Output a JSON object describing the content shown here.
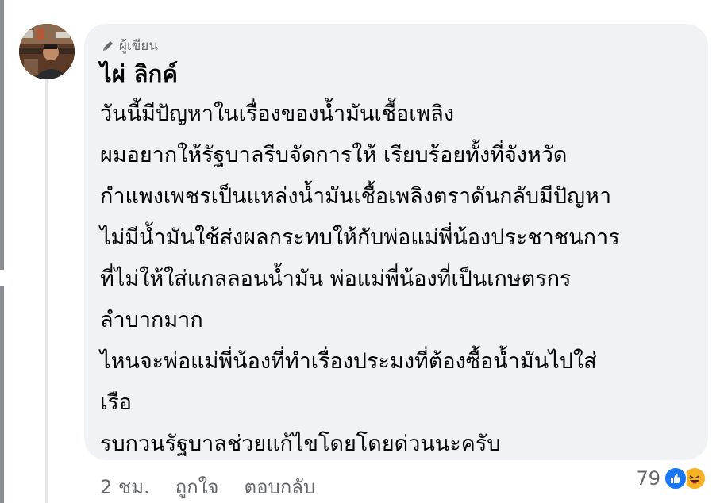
{
  "comment": {
    "author_badge": "ผู้เขียน",
    "author_name": "ไผ่ ลิกค์",
    "lines": [
      "วันนี้มีปัญหาในเรื่องของน้ำมันเชื้อเพลิง",
      "ผมอยากให้รัฐบาลรีบจัดการให้ เรียบร้อยทั้งที่จังหวัด",
      "กำแพงเพชรเป็นแหล่งน้ำมันเชื้อเพลิงตราดันกลับมีปัญหา",
      "ไม่มีน้ำมันใช้ส่งผลกระทบให้กับพ่อแม่พี่น้องประชาชนการ",
      "ที่ไม่ให้ใส่แกลลอนน้ำมัน พ่อแม่พี่น้องที่เป็นเกษตรกร",
      "ลำบากมาก",
      "ไหนจะพ่อแม่พี่น้องที่ทำเรื่องประมงที่ต้องซื้อน้ำมันไปใส่",
      "เรือ",
      "รบกวนรัฐบาลช่วยแก้ไขโดยโดยด่วนนะครับ"
    ]
  },
  "meta": {
    "time": "2 ชม.",
    "like": "ถูกใจ",
    "reply": "ตอบกลับ"
  },
  "reactions": {
    "count": "79",
    "icons": [
      "like-icon",
      "haha-icon"
    ],
    "like_color": "#1877f2",
    "haha_color": "#f7b125"
  }
}
